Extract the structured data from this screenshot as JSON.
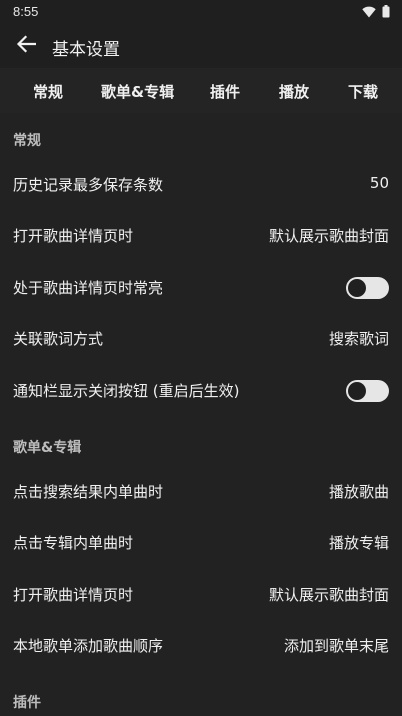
{
  "status_bar": {
    "time": "8:55",
    "wifi_icon": "wifi-icon",
    "battery_icon": "battery-icon"
  },
  "app_bar": {
    "back_icon": "arrow-left-icon",
    "title": "基本设置"
  },
  "tabs": [
    {
      "label": "常规"
    },
    {
      "label": "歌单&专辑"
    },
    {
      "label": "插件"
    },
    {
      "label": "播放"
    },
    {
      "label": "下载"
    }
  ],
  "sections": {
    "general": {
      "header": "常规",
      "history_limit": {
        "label": "历史记录最多保存条数",
        "value": "50"
      },
      "open_detail": {
        "label": "打开歌曲详情页时",
        "value": "默认展示歌曲封面"
      },
      "keep_screen_on": {
        "label": "处于歌曲详情页时常亮",
        "enabled": false
      },
      "lyric_association": {
        "label": "关联歌词方式",
        "value": "搜索歌词"
      },
      "notification_close": {
        "label": "通知栏显示关闭按钮 (重启后生效)",
        "enabled": false
      }
    },
    "playlist_album": {
      "header": "歌单&专辑",
      "search_click": {
        "label": "点击搜索结果内单曲时",
        "value": "播放歌曲"
      },
      "album_click": {
        "label": "点击专辑内单曲时",
        "value": "播放专辑"
      },
      "open_detail": {
        "label": "打开歌曲详情页时",
        "value": "默认展示歌曲封面"
      },
      "local_add_order": {
        "label": "本地歌单添加歌曲顺序",
        "value": "添加到歌单末尾"
      }
    },
    "plugins": {
      "header": "插件"
    }
  },
  "colors": {
    "background": "#222222",
    "bar": "#1f1f1f",
    "text": "#f0f0f0",
    "section_header": "#bdbdbd",
    "toggle_track": "#e6e6e6"
  }
}
